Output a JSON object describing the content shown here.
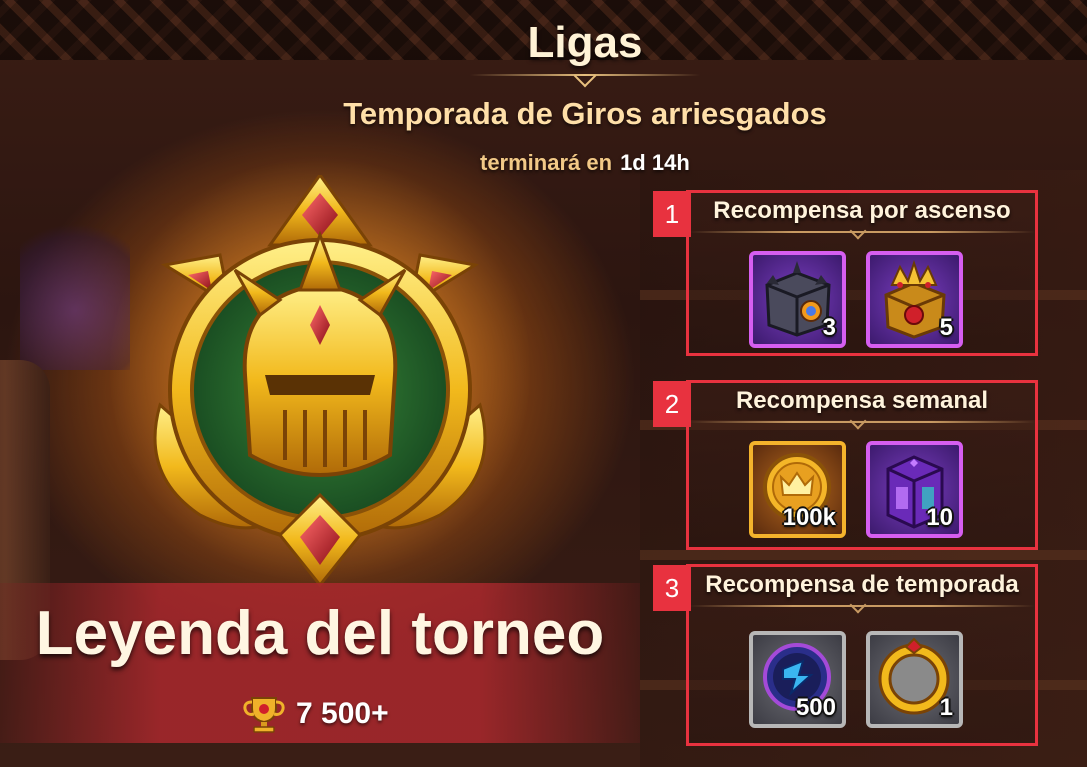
{
  "header": {
    "title": "Ligas",
    "season_name": "Temporada de Giros arriesgados",
    "ends_label": "terminará en",
    "ends_value": "1d 14h"
  },
  "league": {
    "name": "Leyenda del torneo",
    "trophy_requirement": "7 500+",
    "trophy_icon": "trophy-icon",
    "emblem_icon": "golden-knight-helmet-emblem"
  },
  "sections": [
    {
      "number": "1",
      "title": "Recompensa por ascenso",
      "items": [
        {
          "icon": "dark-spiked-chest-icon",
          "quantity": "3",
          "rarity_color": "#d65ef0"
        },
        {
          "icon": "golden-crown-chest-icon",
          "quantity": "5",
          "rarity_color": "#d65ef0"
        }
      ]
    },
    {
      "number": "2",
      "title": "Recompensa semanal",
      "items": [
        {
          "icon": "crown-coin-icon",
          "quantity": "100k",
          "rarity_color": "#f4b32c"
        },
        {
          "icon": "purple-loot-box-icon",
          "quantity": "10",
          "rarity_color": "#d65ef0"
        }
      ]
    },
    {
      "number": "3",
      "title": "Recompensa de temporada",
      "items": [
        {
          "icon": "blue-orb-token-icon",
          "quantity": "500",
          "rarity_color": "#b7b7b7"
        },
        {
          "icon": "golden-avatar-frame-icon",
          "quantity": "1",
          "rarity_color": "#b7b7b7"
        }
      ]
    }
  ],
  "colors": {
    "highlight_red": "#e8323f",
    "title_text": "#fff3d6",
    "season_text": "#ffdfa8",
    "banner_red": "#aa282d"
  }
}
